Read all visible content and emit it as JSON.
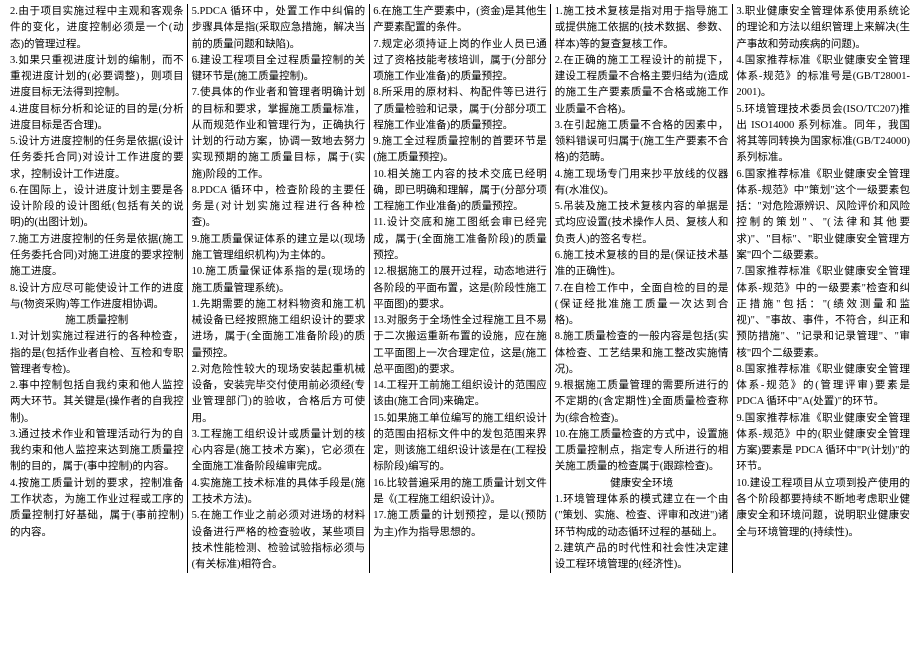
{
  "col1": {
    "i1": "2.由于项目实施过程中主观和客观条件的变化，进度控制必须是一个(动态)的管理过程。",
    "i2": "3.如果只重视进度计划的编制，而不重视进度计划的(必要调整)，则项目进度目标无法得到控制。",
    "i3": "4.进度目标分析和论证的目的是(分析进度目标是否合理)。",
    "i4": "5.设计方进度控制的任务是依据(设计任务委托合同)对设计工作进度的要求，控制设计工作进度。",
    "i5": "6.在国际上，设计进度计划主要是各设计阶段的设计图纸(包括有关的说明)的(出图计划)。",
    "i6": "7.施工方进度控制的任务是依据(施工任务委托合同)对施工进度的要求控制施工进度。",
    "i7": "8.设计方应尽可能使设计工作的进度与(物资采购)等工作进度相协调。",
    "h1": "施工质量控制",
    "i8": "1.对计划实施过程进行的各种检查，指的是(包括作业者自检、互检和专职管理者专检)。",
    "i9": "2.事中控制包括自我约束和他人监控两大环节。其关键是(操作者的自我控制)。",
    "i10": "3.通过技术作业和管理活动行为的自我约束和他人监控来达到施工质量控制的目的，属于(事中控制)的内容。",
    "i11": "4.按施工质量计划的要求，控制准备工作状态，为施工作业过程或工序的质量控制打好基础，属于(事前控制)的内容。",
    "i12": "5.PDCA 循环中，处置工作中纠偏的步骤具体是指(采取应急措施，解决当前的质量问题和缺陷)。",
    "i13": "6.建设工程项目全过程质量控制的关键环节是(施工质量控制)。",
    "i14": "7.使具体的作业者和管理者明确计划的目标和要求，掌握施工质量标准，从而规范作业和管理行为，正确执行计划的行动方案，协调一致地去努力实现预期的施工质量目标，属于(实施)阶段的工作。"
  },
  "col2": {
    "i1": "8.PDCA 循环中，检查阶段的主要任务是(对计划实施过程进行各种检查)。",
    "i2": "9.施工质量保证体系的建立是以(现场施工管理组织机构)为主体的。",
    "i3": "10.施工质量保证体系指的是(现场的施工质量管理系统)。",
    "h1": "1.先期需要的施工材料物资和施工机械设备已经按照施工组织设计的要求进场，属于(全面施工准备阶段)的质量预控。",
    "i4": "2.对危险性较大的现场安装起重机械设备，安装完毕交付使用前必须经(专业管理部门)的验收，合格后方可使用。",
    "i5": "3.工程施工组织设计或质量计划的核心内容是(施工技术方案)，它必须在全面施工准备阶段编审完成。",
    "i6": "4.实施施工技术标准的具体手段是(施工技术方法)。",
    "i7": "5.在施工作业之前必须对进场的材料设备进行严格的检查验收，某些项目技术性能检测、检验试验指标必须与(有关标准)相符合。",
    "i8": "6.在施工生产要素中，(资金)是其他生产要素配置的条件。",
    "i9": "7.规定必须持证上岗的作业人员已通过了资格技能考核培训，属于(分部分项施工作业准备)的质量预控。",
    "i10": "8.所采用的原材料、构配件等已进行了质量检验和记录，属于(分部分项工程施工作业准备)的质量预控。",
    "i11": "9.施工全过程质量控制的首要环节是(施工质量预控)。",
    "i12": "10.相关施工内容的技术交底已经明确，即已明确和理解，属于(分部分项工程施工作业准备)的质量预控。",
    "i13": "11.设计交底和施工图纸会审已经完成，属于(全面施工准备阶段)的质量预控。"
  },
  "col3": {
    "i1": "12.根据施工的展开过程，动态地进行各阶段的平面布置，这是(阶段性施工平面图)的要求。",
    "i2": "13.对服务于全场性全过程施工且不易于二次搬运重新布置的设施，应在施工平面图上一次合理定位，这是(施工总平面图)的要求。",
    "i3": "14.工程开工前施工组织设计的范围应该由(施工合同)来确定。",
    "i4": "15.如果施工单位编写的施工组织设计的范围由招标文件中的发包范围来界定，则该施工组织设计该是在(工程投标阶段)编写的。",
    "i5": "16.比较普遍采用的施工质量计划文件是《(工程施工组织设计)》。",
    "i6": "17.施工质量的计划预控，是以(预防为主)作为指导思想的。",
    "h1": "1.施工技术复核是指对用于指导施工或提供施工依据的(技术数据、参数、样本)等的复查复核工作。",
    "i7": "2.在正确的施工工程设计的前提下，建设工程质量不合格主要归结为(造成的施工生产要素质量不合格或施工作业质量不合格)。",
    "i8": "3.在引起施工质量不合格的因素中，领料错误可归属于(施工生产要素不合格)的范畴。",
    "i9": "4.施工现场专门用来抄平放线的仪器有(水准仪)。",
    "i10": "5.吊装及施工技术复核内容的单据是式均应设置(技术操作人员、复核人和负责人)的签名专栏。",
    "i11": "6.施工技术复核的目的是(保证技术基准的正确性)。",
    "i12": "7.在自检工作中，全面自检的目的是(保证经批准施工质量一次达到合格)。",
    "i13": "8.施工质量检查的一般内容是包括(实体检查、工艺结果和施工整改实施情况)。",
    "i14": "9.根据施工质量管理的需要所进行的不定期的(含定期性)全面质量检查称为(综合检查)。"
  },
  "col4": {
    "i1": "10.在施工质量检查的方式中，设置施工质量控制点，指定专人所进行的相关施工质量的检查属于(跟踪检查)。",
    "h1": "健康安全环境",
    "i2": "1.环境管理体系的模式建立在一个由(\"策划、实施、检查、评审和改进\")诸环节构成的动态循环过程的基础上。",
    "i3": "2.建筑产品的时代性和社会性决定建设工程环境管理的(经济性)。",
    "i4": "3.职业健康安全管理体系使用系统论的理论和方法以组织管理上来解决(生产事故和劳动疾病的问题)。",
    "i5": "4.国家推荐标准《职业健康安全管理体系-规范》的标准号是(GB/T28001-2001)。",
    "i6": "5.环境管理技术委员会(ISO/TC207)推出 ISO14000 系列标准。同年，我国将其等同转换为国家标准(GB/T24000)系列标准。",
    "i7": "6.国家推荐标准《职业健康安全管理体系-规范》中\"策划\"这个一级要素包括：\"对危险源辨识、风险评价和风险控制的策划\"、\"(法律和其他要求)\"、\"目标\"、\"职业健康安全管理方案\"四个二级要素。",
    "i8": "7.国家推荐标准《职业健康安全管理体系-规范》中的一级要素\"检查和纠正措施\"包括：\"(绩效测量和监视)\"、\"事故、事件，不符合，纠正和预防措施\"、\"记录和记录管理\"、\"审核\"四个二级要素。",
    "i9": "8.国家推荐标准《职业健康安全管理体系-规范》的(管理评审)要素是 PDCA 循环中\"A(处置)\"的环节。",
    "i10": "9.国家推荐标准《职业健康安全管理体系-规范》中的(职业健康安全管理方案)要素是 PDCA 循环中\"P(计划)\"的环节。",
    "i11": "10.建设工程项目从立项到投产使用的各个阶段都要持续不断地考虑职业健康安全和环境问题，说明职业健康安全与环境管理的(持续性)。"
  }
}
